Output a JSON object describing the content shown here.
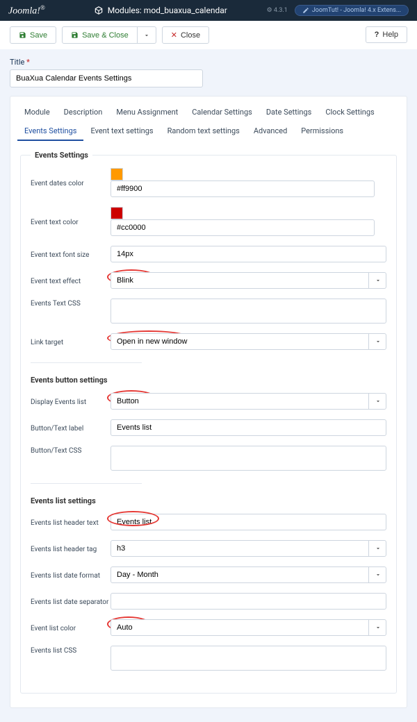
{
  "top": {
    "brand": "Joomla!",
    "module_title": "Modules: mod_buaxua_calendar",
    "version": "4.3.1",
    "tour_label": "JoomTut! - Joomla! 4.x Extens..."
  },
  "toolbar": {
    "save": "Save",
    "save_close": "Save & Close",
    "close": "Close",
    "help": "Help"
  },
  "title_label": "Title",
  "title_value": "BuaXua Calendar Events Settings",
  "tabs": [
    "Module",
    "Description",
    "Menu Assignment",
    "Calendar Settings",
    "Date Settings",
    "Clock Settings",
    "Events Settings",
    "Event text settings",
    "Random text settings",
    "Advanced",
    "Permissions"
  ],
  "active_tab": 6,
  "fieldset_legend": "Events Settings",
  "f": {
    "event_dates_color_l": "Event dates color",
    "event_dates_color_v": "#ff9900",
    "event_text_color_l": "Event text color",
    "event_text_color_v": "#cc0000",
    "event_text_font_size_l": "Event text font size",
    "event_text_font_size_v": "14px",
    "event_text_effect_l": "Event text effect",
    "event_text_effect_v": "Blink",
    "events_text_css_l": "Events Text CSS",
    "events_text_css_v": "",
    "link_target_l": "Link target",
    "link_target_v": "Open in new window"
  },
  "btn_section": "Events button settings",
  "b": {
    "display_events_list_l": "Display Events list",
    "display_events_list_v": "Button",
    "button_text_label_l": "Button/Text label",
    "button_text_label_v": "Events list",
    "button_text_css_l": "Button/Text CSS",
    "button_text_css_v": ""
  },
  "list_section": "Events list settings",
  "l": {
    "header_text_l": "Events list header text",
    "header_text_v": "Events list",
    "header_tag_l": "Events list header tag",
    "header_tag_v": "h3",
    "date_format_l": "Events list date format",
    "date_format_v": "Day - Month",
    "date_sep_l": "Events list date separator",
    "date_sep_v": "",
    "list_color_l": "Event list color",
    "list_color_v": "Auto",
    "list_css_l": "Events list CSS",
    "list_css_v": ""
  }
}
